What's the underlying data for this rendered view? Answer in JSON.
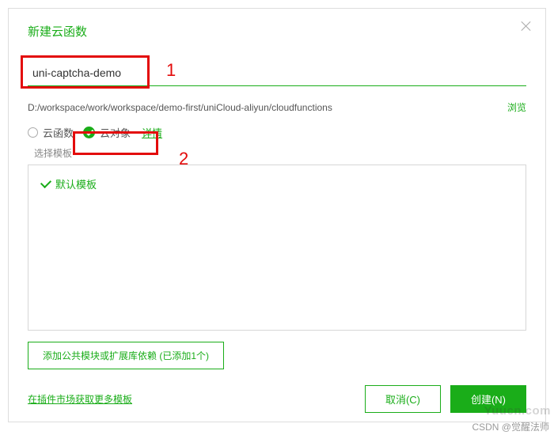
{
  "dialog": {
    "title": "新建云函数",
    "close_icon": "close-icon"
  },
  "name_field": {
    "value": "uni-captcha-demo",
    "placeholder": ""
  },
  "path_row": {
    "path": "D:/workspace/work/workspace/demo-first/uniCloud-aliyun/cloudfunctions",
    "browse": "浏览"
  },
  "type": {
    "cloud_function": "云函数",
    "cloud_object": "云对象",
    "details": "详情",
    "selected": "cloud_object"
  },
  "template": {
    "section_label": "选择模板",
    "default_name": "默认模板"
  },
  "add_module_btn": "添加公共模块或扩展库依赖 (已添加1个)",
  "footer": {
    "more_templates": "在插件市场获取更多模板",
    "cancel": "取消(C)",
    "create": "创建(N)"
  },
  "annotations": {
    "marker1": "1",
    "marker2": "2"
  },
  "watermark": "Yuucn.com",
  "credit": "CSDN @觉醒法师"
}
